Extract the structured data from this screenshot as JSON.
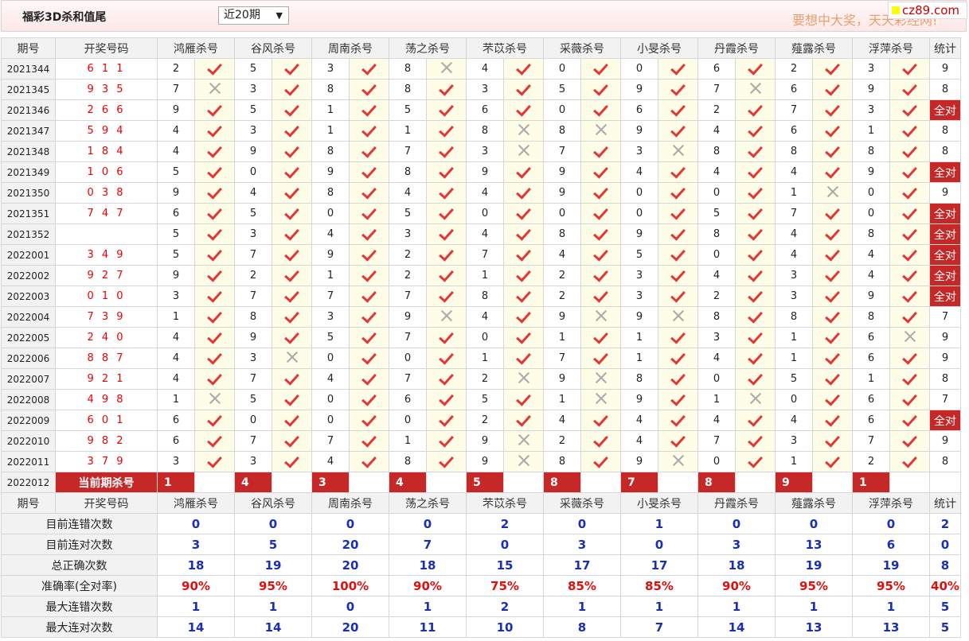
{
  "header": {
    "title": "福彩3D杀和值尾",
    "period_select": "近20期",
    "slogan": "要想中大奖，天天彩经网!",
    "logo_text": "cz89.com"
  },
  "columns": {
    "issue": "期号",
    "draw": "开奖号码",
    "experts": [
      "鸿雁杀号",
      "谷风杀号",
      "周南杀号",
      "荡之杀号",
      "芣苡杀号",
      "采薇杀号",
      "小旻杀号",
      "丹霞杀号",
      "薤露杀号",
      "浮萍杀号"
    ],
    "stat": "统计"
  },
  "rows": [
    {
      "issue": "2021344",
      "draw": "6 1 1",
      "kills": [
        2,
        5,
        3,
        8,
        4,
        0,
        0,
        6,
        2,
        3
      ],
      "hits": [
        1,
        1,
        1,
        0,
        1,
        1,
        1,
        1,
        1,
        1
      ],
      "stat": "9"
    },
    {
      "issue": "2021345",
      "draw": "9 3 5",
      "kills": [
        7,
        3,
        8,
        8,
        3,
        5,
        9,
        7,
        6,
        9
      ],
      "hits": [
        0,
        1,
        1,
        1,
        1,
        1,
        1,
        0,
        1,
        1
      ],
      "stat": "8"
    },
    {
      "issue": "2021346",
      "draw": "2 6 6",
      "kills": [
        9,
        5,
        1,
        5,
        6,
        0,
        6,
        2,
        7,
        3
      ],
      "hits": [
        1,
        1,
        1,
        1,
        1,
        1,
        1,
        1,
        1,
        1
      ],
      "stat": "全对"
    },
    {
      "issue": "2021347",
      "draw": "5 9 4",
      "kills": [
        4,
        3,
        1,
        1,
        8,
        8,
        9,
        4,
        6,
        1
      ],
      "hits": [
        1,
        1,
        1,
        1,
        0,
        0,
        1,
        1,
        1,
        1
      ],
      "stat": "8"
    },
    {
      "issue": "2021348",
      "draw": "1 8 4",
      "kills": [
        4,
        9,
        8,
        7,
        3,
        7,
        3,
        8,
        8,
        8
      ],
      "hits": [
        1,
        1,
        1,
        1,
        0,
        1,
        0,
        1,
        1,
        1
      ],
      "stat": "8"
    },
    {
      "issue": "2021349",
      "draw": "1 0 6",
      "kills": [
        5,
        0,
        9,
        8,
        9,
        9,
        4,
        4,
        4,
        9
      ],
      "hits": [
        1,
        1,
        1,
        1,
        1,
        1,
        1,
        1,
        1,
        1
      ],
      "stat": "全对"
    },
    {
      "issue": "2021350",
      "draw": "0 3 8",
      "kills": [
        9,
        4,
        8,
        4,
        4,
        9,
        0,
        0,
        1,
        0
      ],
      "hits": [
        1,
        1,
        1,
        1,
        1,
        1,
        1,
        1,
        0,
        1
      ],
      "stat": "9"
    },
    {
      "issue": "2021351",
      "draw": "7 4 7",
      "kills": [
        6,
        5,
        0,
        5,
        0,
        0,
        0,
        5,
        7,
        0
      ],
      "hits": [
        1,
        1,
        1,
        1,
        1,
        1,
        1,
        1,
        1,
        1
      ],
      "stat": "全对"
    },
    {
      "issue": "2021352",
      "draw": "",
      "kills": [
        5,
        3,
        4,
        3,
        4,
        8,
        9,
        8,
        4,
        8
      ],
      "hits": [
        1,
        1,
        1,
        1,
        1,
        1,
        1,
        1,
        1,
        1
      ],
      "stat": "全对"
    },
    {
      "issue": "2022001",
      "draw": "3 4 9",
      "kills": [
        5,
        7,
        9,
        2,
        7,
        4,
        5,
        0,
        4,
        4
      ],
      "hits": [
        1,
        1,
        1,
        1,
        1,
        1,
        1,
        1,
        1,
        1
      ],
      "stat": "全对"
    },
    {
      "issue": "2022002",
      "draw": "9 2 7",
      "kills": [
        9,
        2,
        1,
        2,
        1,
        2,
        3,
        4,
        3,
        4
      ],
      "hits": [
        1,
        1,
        1,
        1,
        1,
        1,
        1,
        1,
        1,
        1
      ],
      "stat": "全对"
    },
    {
      "issue": "2022003",
      "draw": "0 1 0",
      "kills": [
        3,
        7,
        7,
        7,
        8,
        2,
        3,
        2,
        3,
        9
      ],
      "hits": [
        1,
        1,
        1,
        1,
        1,
        1,
        1,
        1,
        1,
        1
      ],
      "stat": "全对"
    },
    {
      "issue": "2022004",
      "draw": "7 3 9",
      "kills": [
        1,
        8,
        3,
        9,
        4,
        9,
        9,
        8,
        8,
        8
      ],
      "hits": [
        1,
        1,
        1,
        0,
        1,
        0,
        0,
        1,
        1,
        1
      ],
      "stat": "7"
    },
    {
      "issue": "2022005",
      "draw": "2 4 0",
      "kills": [
        4,
        9,
        5,
        7,
        0,
        1,
        1,
        3,
        1,
        6
      ],
      "hits": [
        1,
        1,
        1,
        1,
        1,
        1,
        1,
        1,
        1,
        0
      ],
      "stat": "9"
    },
    {
      "issue": "2022006",
      "draw": "8 8 7",
      "kills": [
        4,
        3,
        0,
        0,
        1,
        7,
        1,
        4,
        1,
        6
      ],
      "hits": [
        1,
        0,
        1,
        1,
        1,
        1,
        1,
        1,
        1,
        1
      ],
      "stat": "9"
    },
    {
      "issue": "2022007",
      "draw": "9 2 1",
      "kills": [
        4,
        7,
        4,
        7,
        2,
        9,
        8,
        0,
        5,
        1
      ],
      "hits": [
        1,
        1,
        1,
        1,
        0,
        0,
        1,
        1,
        1,
        1
      ],
      "stat": "8"
    },
    {
      "issue": "2022008",
      "draw": "4 9 8",
      "kills": [
        1,
        5,
        0,
        6,
        5,
        1,
        9,
        1,
        0,
        6
      ],
      "hits": [
        0,
        1,
        1,
        1,
        1,
        0,
        1,
        0,
        1,
        1
      ],
      "stat": "7"
    },
    {
      "issue": "2022009",
      "draw": "6 0 1",
      "kills": [
        6,
        0,
        0,
        0,
        2,
        4,
        4,
        4,
        4,
        6
      ],
      "hits": [
        1,
        1,
        1,
        1,
        1,
        1,
        1,
        1,
        1,
        1
      ],
      "stat": "全对"
    },
    {
      "issue": "2022010",
      "draw": "9 8 2",
      "kills": [
        6,
        7,
        7,
        1,
        9,
        2,
        4,
        7,
        3,
        7
      ],
      "hits": [
        1,
        1,
        1,
        1,
        0,
        1,
        1,
        1,
        1,
        1
      ],
      "stat": "9"
    },
    {
      "issue": "2022011",
      "draw": "3 7 9",
      "kills": [
        3,
        3,
        4,
        8,
        9,
        8,
        9,
        0,
        1,
        2
      ],
      "hits": [
        1,
        1,
        1,
        1,
        0,
        1,
        0,
        1,
        1,
        1
      ],
      "stat": "8"
    }
  ],
  "current": {
    "issue": "2022012",
    "label": "当前期杀号",
    "kills": [
      1,
      4,
      3,
      4,
      5,
      8,
      7,
      8,
      9,
      1
    ]
  },
  "stats": [
    {
      "label": "目前连错次数",
      "values": [
        "0",
        "0",
        "0",
        "0",
        "2",
        "0",
        "1",
        "0",
        "0",
        "0"
      ],
      "total": "2",
      "style": "blue"
    },
    {
      "label": "目前连对次数",
      "values": [
        "3",
        "5",
        "20",
        "7",
        "0",
        "3",
        "0",
        "3",
        "13",
        "6"
      ],
      "total": "0",
      "style": "blue"
    },
    {
      "label": "总正确次数",
      "values": [
        "18",
        "19",
        "20",
        "18",
        "15",
        "17",
        "17",
        "18",
        "19",
        "19"
      ],
      "total": "8",
      "style": "blue"
    },
    {
      "label": "准确率(全对率)",
      "values": [
        "90%",
        "95%",
        "100%",
        "90%",
        "75%",
        "85%",
        "85%",
        "90%",
        "95%",
        "95%"
      ],
      "total": "40%",
      "style": "red"
    },
    {
      "label": "最大连错次数",
      "values": [
        "1",
        "1",
        "0",
        "1",
        "2",
        "1",
        "1",
        "1",
        "1",
        "1"
      ],
      "total": "5",
      "style": "blue"
    },
    {
      "label": "最大连对次数",
      "values": [
        "14",
        "14",
        "20",
        "11",
        "10",
        "8",
        "7",
        "14",
        "13",
        "13"
      ],
      "total": "5",
      "style": "blue"
    }
  ],
  "colors": {
    "accent": "#c62828",
    "tick": "#e53535",
    "stat_blue": "#1a2fb4",
    "stat_red": "#e01010"
  }
}
